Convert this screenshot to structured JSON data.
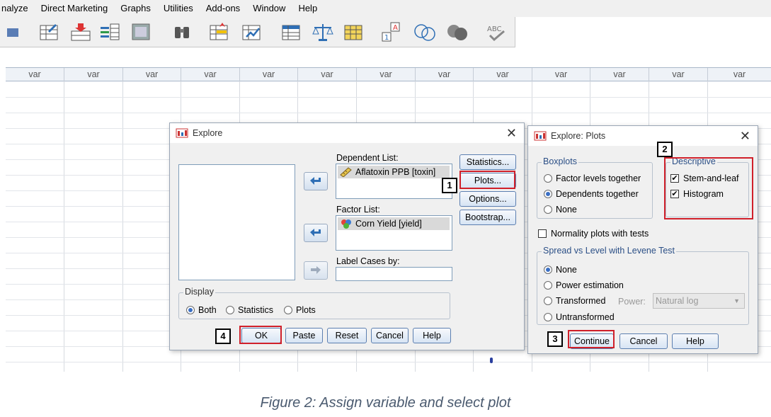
{
  "menu": [
    "nalyze",
    "Direct Marketing",
    "Graphs",
    "Utilities",
    "Add-ons",
    "Window",
    "Help"
  ],
  "sheet": {
    "column_header": "var",
    "column_count": 13
  },
  "explore": {
    "title": "Explore",
    "dependent_label": "Dependent List:",
    "dependent_item": "Aflatoxin PPB [toxin]",
    "factor_label": "Factor List:",
    "factor_item": "Corn Yield [yield]",
    "label_cases": "Label Cases by:",
    "side_buttons": [
      "Statistics...",
      "Plots...",
      "Options...",
      "Bootstrap..."
    ],
    "display_title": "Display",
    "display_options": [
      "Both",
      "Statistics",
      "Plots"
    ],
    "display_selected": "Both",
    "bottom_buttons": [
      "OK",
      "Paste",
      "Reset",
      "Cancel",
      "Help"
    ]
  },
  "plots": {
    "title": "Explore: Plots",
    "boxplots_title": "Boxplots",
    "boxplots_options": [
      "Factor levels together",
      "Dependents together",
      "None"
    ],
    "boxplots_selected": "Dependents together",
    "descriptive_title": "Descriptive",
    "descriptive_options": [
      "Stem-and-leaf",
      "Histogram"
    ],
    "descriptive_checked": [
      true,
      true
    ],
    "normality": "Normality plots with tests",
    "normality_checked": false,
    "spread_title": "Spread vs Level with Levene Test",
    "spread_options": [
      "None",
      "Power estimation",
      "Transformed",
      "Untransformed"
    ],
    "spread_selected": "None",
    "power_label": "Power:",
    "power_value": "Natural log",
    "buttons": [
      "Continue",
      "Cancel",
      "Help"
    ]
  },
  "steps": [
    "1",
    "2",
    "3",
    "4"
  ],
  "caption": "Figure 2: Assign variable and select plot",
  "colors": {
    "highlight": "#d0202a",
    "accent": "#3a6fc4"
  }
}
